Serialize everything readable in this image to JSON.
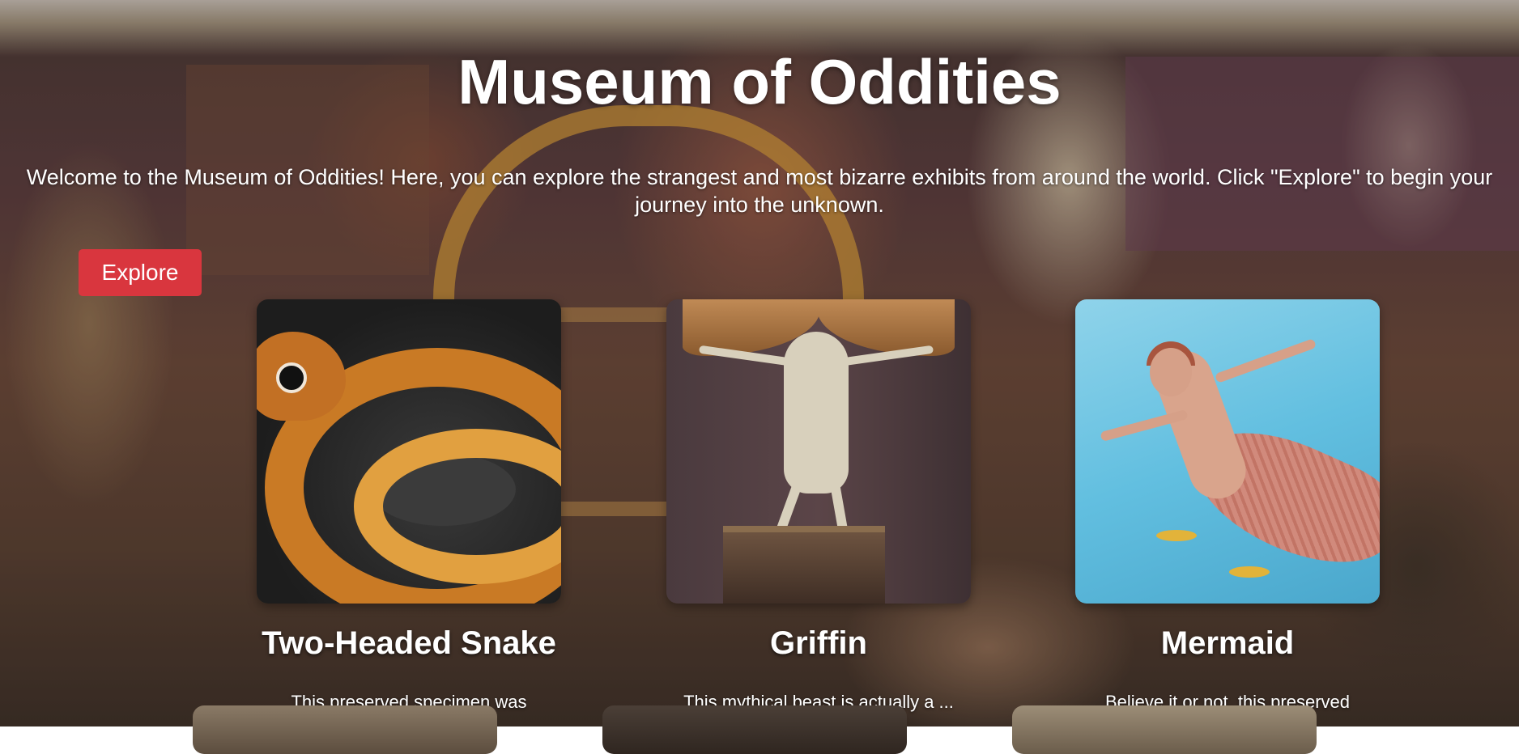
{
  "page": {
    "title": "Museum of Oddities",
    "intro": "Welcome to the Museum of Oddities! Here, you can explore the strangest and most bizarre exhibits from around the world. Click \"Explore\" to begin your journey into the unknown.",
    "explore_label": "Explore"
  },
  "colors": {
    "button_bg": "#d9363e",
    "text": "#ffffff"
  },
  "exhibits": [
    {
      "name": "Two-Headed Snake",
      "description": "This preserved specimen was true...",
      "image": "snake-image"
    },
    {
      "name": "Griffin",
      "description": "This mythical beast is actually a ... eagle...",
      "image": "griffin-image"
    },
    {
      "name": "Mermaid",
      "description": "Believe it or not, this preserved ...half-fish...",
      "image": "mermaid-image"
    }
  ]
}
